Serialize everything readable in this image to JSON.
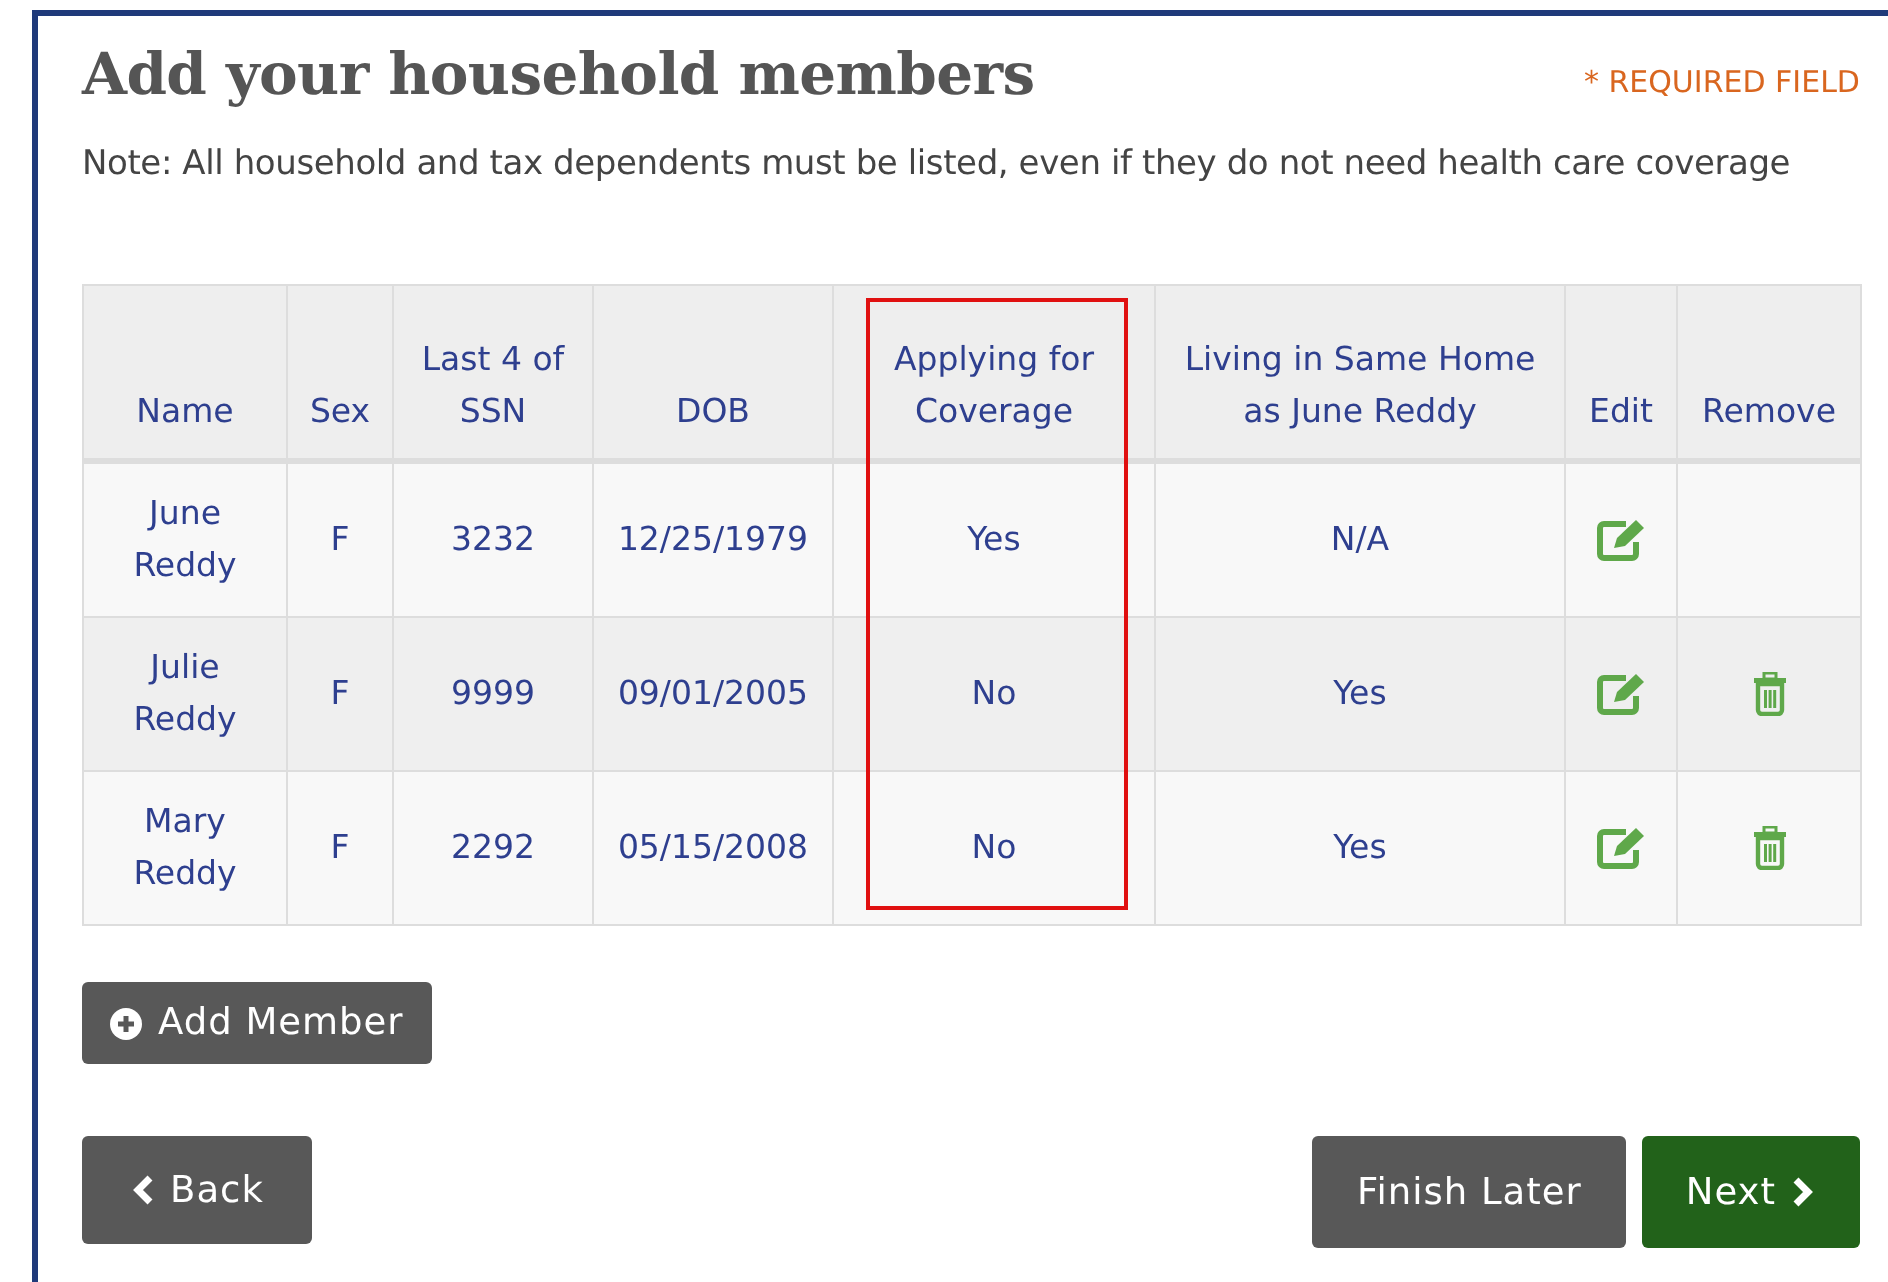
{
  "page": {
    "title": "Add your household members",
    "required_note": "* REQUIRED FIELD",
    "note": "Note: All household and tax dependents must be listed, even if they do not need health care coverage"
  },
  "table": {
    "columns": [
      {
        "label": "Name",
        "highlighted": false
      },
      {
        "label": "Sex",
        "highlighted": false
      },
      {
        "label": "Last 4 of SSN",
        "highlighted": false
      },
      {
        "label": "DOB",
        "highlighted": false
      },
      {
        "label": "Applying for Coverage",
        "highlighted": true
      },
      {
        "label": "Living in Same Home as June Reddy",
        "highlighted": false
      },
      {
        "label": "Edit",
        "highlighted": false
      },
      {
        "label": "Remove",
        "highlighted": false
      }
    ],
    "rows": [
      {
        "name": "June Reddy",
        "sex": "F",
        "ssn_last4": "3232",
        "dob": "12/25/1979",
        "applying": "Yes",
        "same_home": "N/A",
        "editable": true,
        "removable": false
      },
      {
        "name": "Julie Reddy",
        "sex": "F",
        "ssn_last4": "9999",
        "dob": "09/01/2005",
        "applying": "No",
        "same_home": "Yes",
        "editable": true,
        "removable": true
      },
      {
        "name": "Mary Reddy",
        "sex": "F",
        "ssn_last4": "2292",
        "dob": "05/15/2008",
        "applying": "No",
        "same_home": "Yes",
        "editable": true,
        "removable": true
      }
    ]
  },
  "buttons": [
    {
      "kind": "add",
      "label": "Add Member"
    },
    {
      "kind": "back",
      "label": "Back"
    },
    {
      "kind": "later",
      "label": "Finish Later"
    },
    {
      "kind": "next",
      "label": "Next"
    }
  ]
}
